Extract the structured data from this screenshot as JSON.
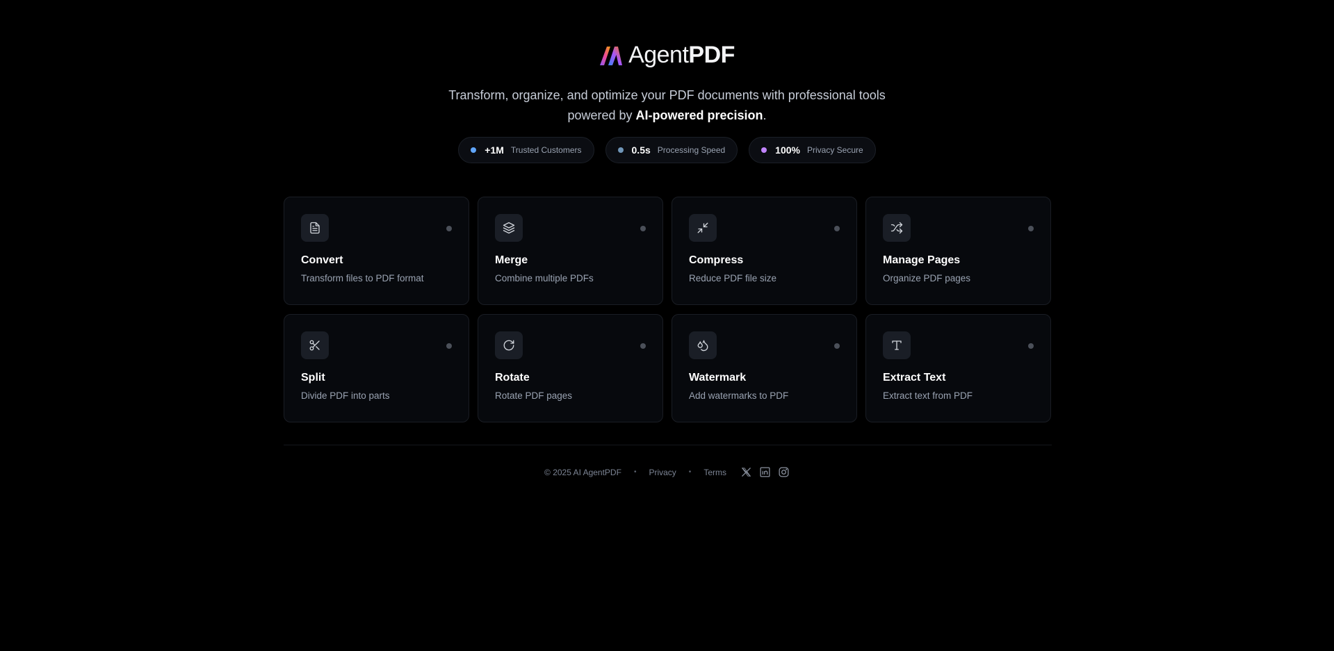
{
  "brand": {
    "name_light": "Agent",
    "name_bold": "PDF"
  },
  "tagline": {
    "line1": "Transform, organize, and optimize your PDF documents with professional tools",
    "line2_prefix": "powered by ",
    "line2_strong": "AI-powered precision",
    "line2_suffix": "."
  },
  "stats": [
    {
      "value": "+1M",
      "label": "Trusted Customers",
      "dot_color": "#60a5fa"
    },
    {
      "value": "0.5s",
      "label": "Processing Speed",
      "dot_color": "#7096b8"
    },
    {
      "value": "100%",
      "label": "Privacy Secure",
      "dot_color": "#c084fc"
    }
  ],
  "tools": [
    {
      "title": "Convert",
      "description": "Transform files to PDF format",
      "icon": "file-text-icon"
    },
    {
      "title": "Merge",
      "description": "Combine multiple PDFs",
      "icon": "layers-icon"
    },
    {
      "title": "Compress",
      "description": "Reduce PDF file size",
      "icon": "minimize-icon"
    },
    {
      "title": "Manage Pages",
      "description": "Organize PDF pages",
      "icon": "shuffle-icon"
    },
    {
      "title": "Split",
      "description": "Divide PDF into parts",
      "icon": "scissors-icon"
    },
    {
      "title": "Rotate",
      "description": "Rotate PDF pages",
      "icon": "rotate-icon"
    },
    {
      "title": "Watermark",
      "description": "Add watermarks to PDF",
      "icon": "droplets-icon"
    },
    {
      "title": "Extract Text",
      "description": "Extract text from PDF",
      "icon": "type-icon"
    }
  ],
  "footer": {
    "copyright": "© 2025 AI AgentPDF",
    "separator": "•",
    "privacy": "Privacy",
    "terms": "Terms",
    "socials": [
      "x-icon",
      "linkedin-icon",
      "instagram-icon"
    ]
  }
}
